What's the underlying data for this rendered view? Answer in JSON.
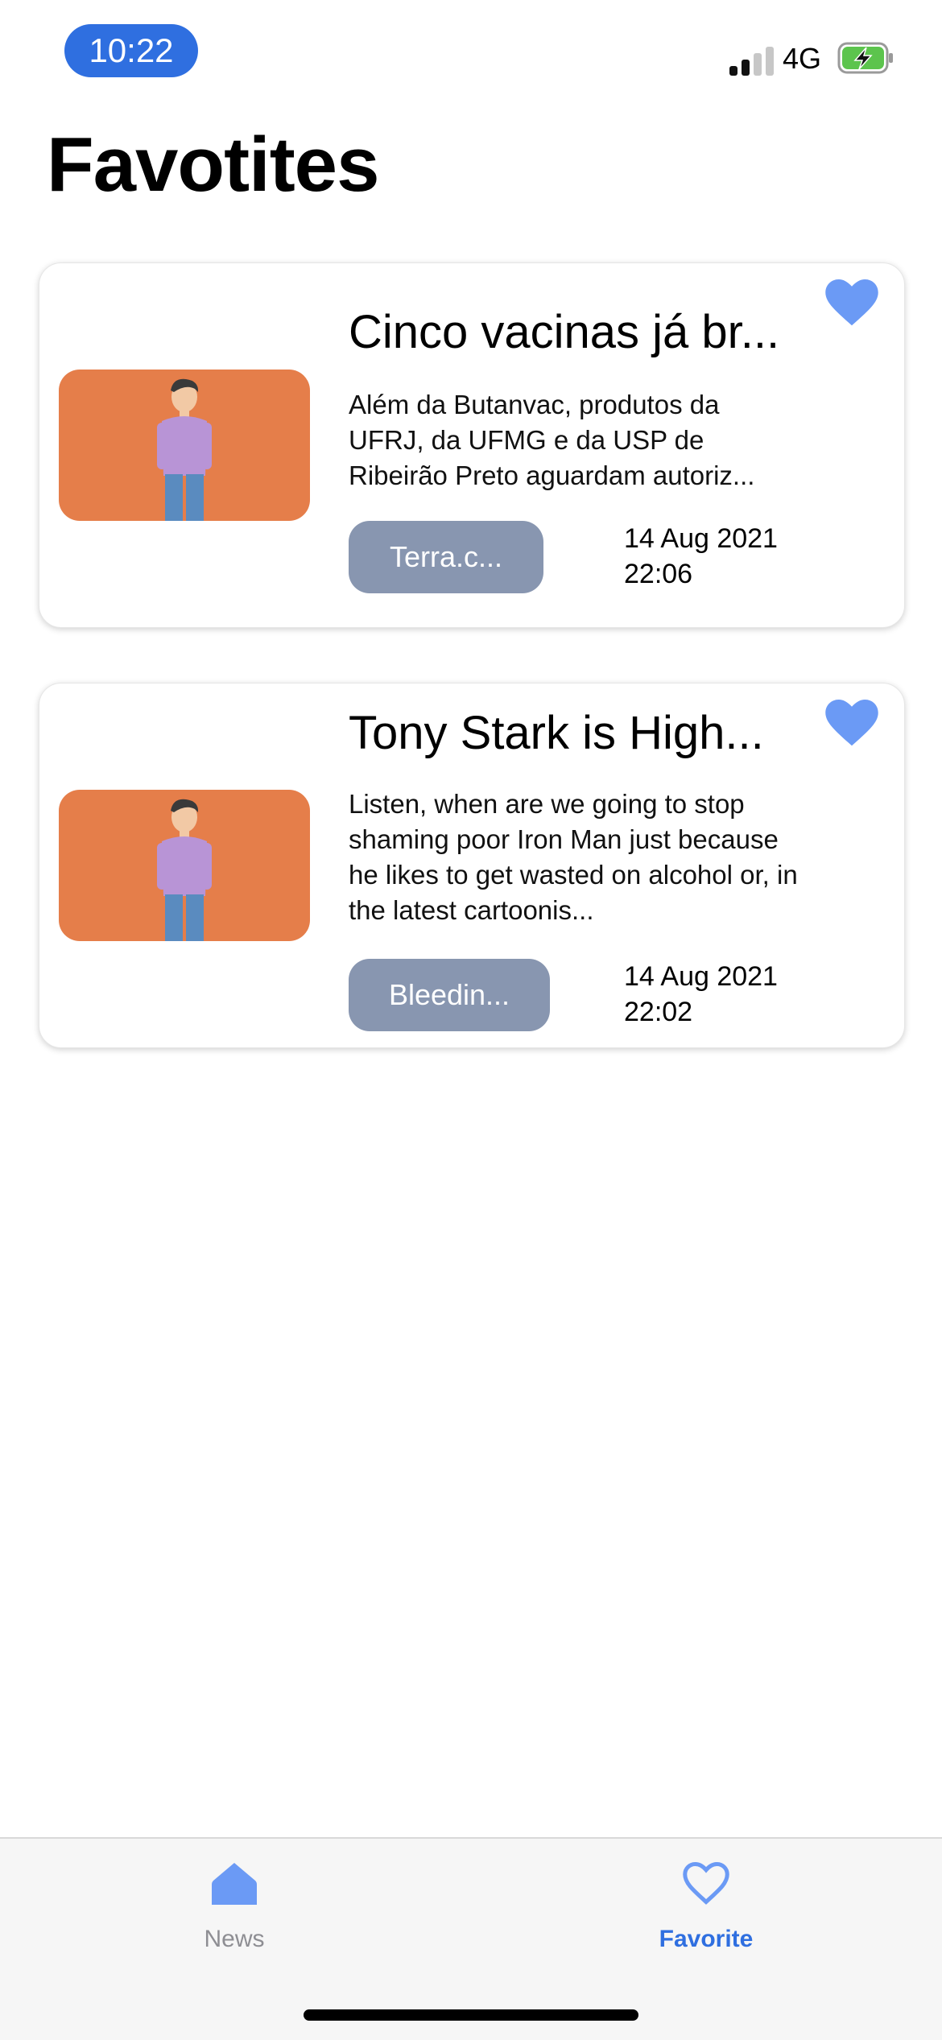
{
  "status_bar": {
    "time": "10:22",
    "network": "4G",
    "icons": [
      "signal-icon",
      "battery-charging-icon"
    ]
  },
  "page": {
    "title": "Favotites"
  },
  "favorites": [
    {
      "title": "Cinco vacinas já br...",
      "description": "Além da Butanvac, produtos da UFRJ, da UFMG e da USP de Ribeirão Preto aguardam autoriz...",
      "source": "Terra.c...",
      "date": "14 Aug 2021",
      "time": "22:06",
      "favorited": true
    },
    {
      "title": "Tony Stark is High...",
      "description": "Listen, when are we going to stop shaming poor Iron Man just because he likes to get wasted on alcohol or, in the latest cartoonis...",
      "source": "Bleedin...",
      "date": "14 Aug 2021",
      "time": "22:02",
      "favorited": true
    }
  ],
  "tab_bar": {
    "tabs": [
      {
        "label": "News",
        "icon": "home-icon",
        "active": false
      },
      {
        "label": "Favorite",
        "icon": "heart-outline-icon",
        "active": true
      }
    ]
  },
  "colors": {
    "accent": "#2f6fe0",
    "heart": "#6b9af5",
    "thumbnail_bg": "#e57e4a",
    "source_button": "#8896b0",
    "inactive_tab": "#8e8e93"
  }
}
